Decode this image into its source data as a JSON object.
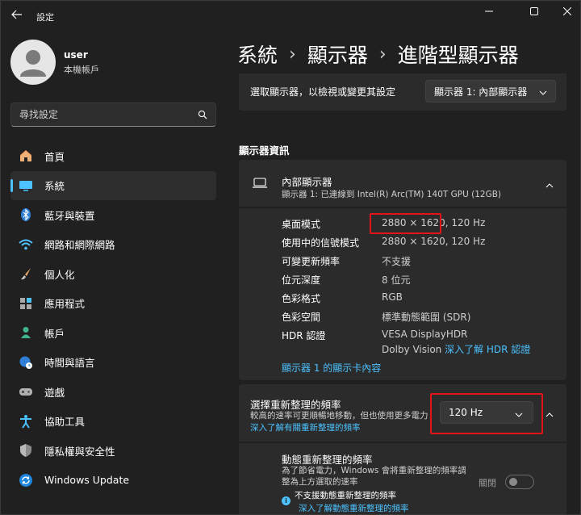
{
  "window": {
    "title": "設定",
    "controls": [
      "minimize-icon",
      "maximize-icon",
      "close-icon"
    ]
  },
  "profile": {
    "name": "user",
    "account_type": "本機帳戶"
  },
  "search": {
    "placeholder": "尋找設定"
  },
  "sidebar": {
    "items": [
      {
        "label": "首頁",
        "icon": "home-icon",
        "active": false
      },
      {
        "label": "系統",
        "icon": "system-icon",
        "active": true
      },
      {
        "label": "藍牙與裝置",
        "icon": "bluetooth-icon",
        "active": false
      },
      {
        "label": "網路和網際網路",
        "icon": "wifi-icon",
        "active": false
      },
      {
        "label": "個人化",
        "icon": "brush-icon",
        "active": false
      },
      {
        "label": "應用程式",
        "icon": "apps-icon",
        "active": false
      },
      {
        "label": "帳戶",
        "icon": "account-icon",
        "active": false
      },
      {
        "label": "時間與語言",
        "icon": "globe-clock-icon",
        "active": false
      },
      {
        "label": "遊戲",
        "icon": "gamepad-icon",
        "active": false
      },
      {
        "label": "協助工具",
        "icon": "accessibility-icon",
        "active": false
      },
      {
        "label": "隱私權與安全性",
        "icon": "shield-icon",
        "active": false
      },
      {
        "label": "Windows Update",
        "icon": "update-icon",
        "active": false
      }
    ]
  },
  "breadcrumb": {
    "part1": "系統",
    "part2": "顯示器",
    "part3": "進階型顯示器"
  },
  "select_display": {
    "label": "選取顯示器，以檢視或變更其設定",
    "value": "顯示器 1: 內部顯示器"
  },
  "display_info": {
    "section_title": "顯示器資訊",
    "name": "內部顯示器",
    "subtitle": "顯示器 1: 已連線到 Intel(R) Arc(TM) 140T GPU (12GB)",
    "rows": [
      {
        "label": "桌面模式",
        "value": "2880 × 1620, 120 Hz"
      },
      {
        "label": "使用中的信號模式",
        "value": "2880 × 1620, 120 Hz"
      },
      {
        "label": "可變更新頻率",
        "value": "不支援"
      },
      {
        "label": "位元深度",
        "value": "8 位元"
      },
      {
        "label": "色彩格式",
        "value": "RGB"
      },
      {
        "label": "色彩空間",
        "value": "標準動態範圍 (SDR)"
      },
      {
        "label": "HDR 認證",
        "value": "VESA DisplayHDR"
      }
    ],
    "hdr_value_line2": "Dolby Vision",
    "hdr_link": "深入了解 HDR 認證",
    "adapter_link": "顯示器 1 的顯示卡內容"
  },
  "refresh_rate": {
    "title": "選擇重新整理的頻率",
    "desc_text": "較高的速率可更順暢地移動，但也使用更多電力",
    "desc_link": "深入了解有關重新整理的頻率",
    "value": "120 Hz"
  },
  "dynamic_refresh": {
    "title": "動態重新整理的頻率",
    "desc": "為了節省電力，Windows 會將重新整理的頻率調整為上方選取的速率",
    "toggle_label": "關閉",
    "toggle_on": false,
    "warning_title": "不支援動態重新整理的頻率",
    "warning_link": "深入了解動態重新整理的頻率"
  },
  "colors": {
    "accent": "#4cc2ff",
    "highlight": "#e1141b",
    "background": "#202020",
    "card": "#2b2b2b"
  }
}
